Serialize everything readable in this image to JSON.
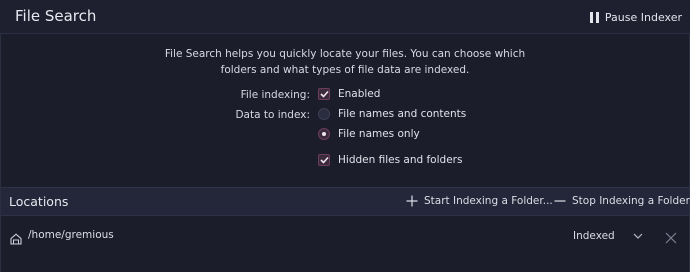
{
  "header": {
    "title": "File Search",
    "pause_label": "Pause Indexer"
  },
  "description": {
    "line1": "File Search helps you quickly locate your files. You can choose which",
    "line2": "folders and what types of file data are indexed."
  },
  "form": {
    "indexing_label": "File indexing:",
    "indexing_value": "Enabled",
    "data_label": "Data to index:",
    "option_contents": "File names and contents",
    "option_names_only": "File names only",
    "selected_option": "File names only",
    "hidden_files": "Hidden files and folders"
  },
  "locations": {
    "title": "Locations",
    "start_label": "Start Indexing a Folder...",
    "stop_label": "Stop Indexing a Folder...",
    "rows": [
      {
        "path": "/home/gremious",
        "status": "Indexed"
      }
    ]
  },
  "colors": {
    "background": "#1b1d2b",
    "accent": "#6d3d5e",
    "text": "#dcdde6"
  },
  "icons": {
    "pause": "pause-icon",
    "check": "checkmark-icon",
    "add": "plus-icon",
    "remove": "minus-icon",
    "home": "home-folder-icon",
    "dropdown": "chevron-down-icon",
    "close": "close-icon"
  }
}
